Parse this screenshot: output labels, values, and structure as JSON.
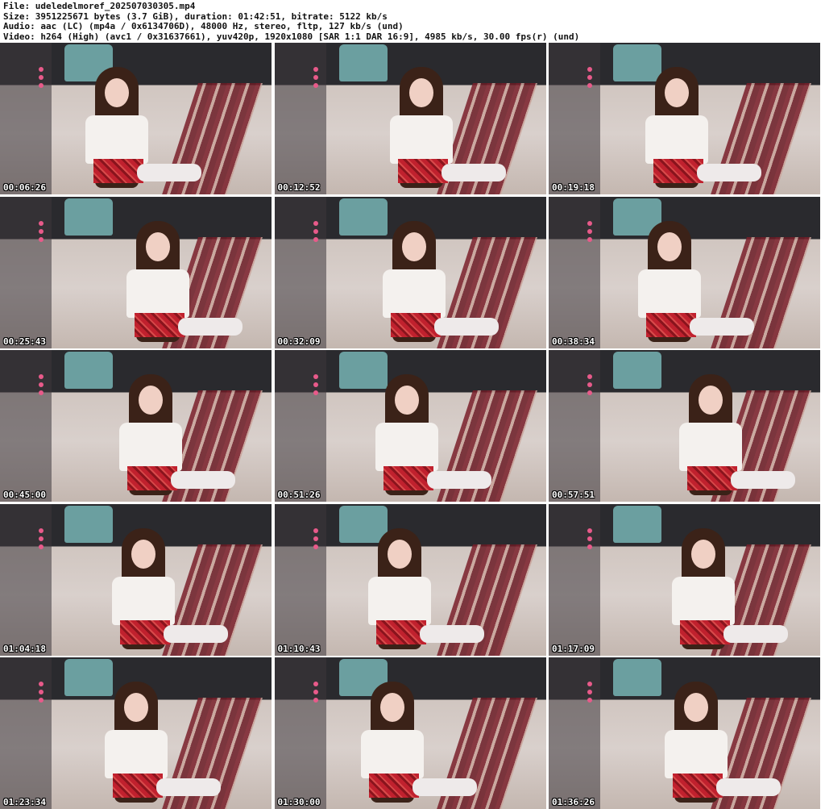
{
  "header": {
    "file_line": "File: udeledelmoref_202507030305.mp4",
    "size_line": "Size: 3951225671 bytes (3.7 GiB), duration: 01:42:51, bitrate: 5122 kb/s",
    "audio_line": "Audio: aac (LC) (mp4a / 0x6134706D), 48000 Hz, stereo, fltp, 127 kb/s (und)",
    "video_line": "Video: h264 (High) (avc1 / 0x31637661), yuv420p, 1920x1080 [SAR 1:1 DAR 16:9], 4985 kb/s, 30.00 fps(r) (und)"
  },
  "thumbnails": [
    {
      "timestamp": "00:06:26"
    },
    {
      "timestamp": "00:12:52"
    },
    {
      "timestamp": "00:19:18"
    },
    {
      "timestamp": "00:25:43"
    },
    {
      "timestamp": "00:32:09"
    },
    {
      "timestamp": "00:38:34"
    },
    {
      "timestamp": "00:45:00"
    },
    {
      "timestamp": "00:51:26"
    },
    {
      "timestamp": "00:57:51"
    },
    {
      "timestamp": "01:04:18"
    },
    {
      "timestamp": "01:10:43"
    },
    {
      "timestamp": "01:17:09"
    },
    {
      "timestamp": "01:23:34"
    },
    {
      "timestamp": "01:30:00"
    },
    {
      "timestamp": "01:36:26"
    }
  ]
}
